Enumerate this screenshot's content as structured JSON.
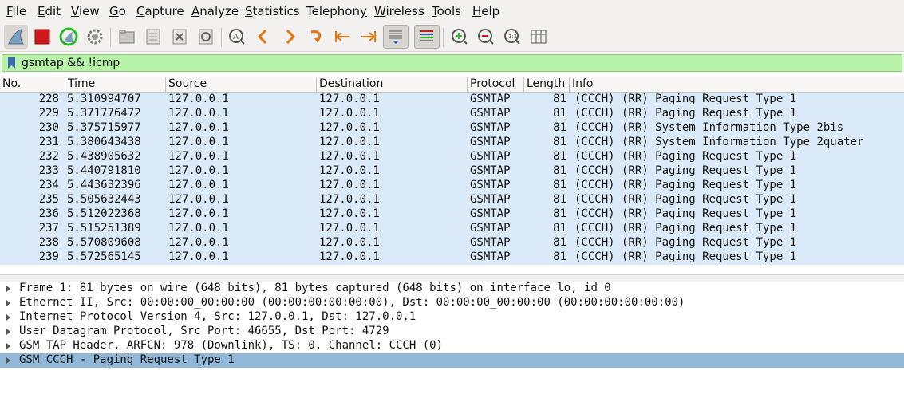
{
  "menu": [
    {
      "key": "F",
      "rest": "ile"
    },
    {
      "key": "E",
      "rest": "dit"
    },
    {
      "key": "V",
      "rest": "iew"
    },
    {
      "key": "G",
      "rest": "o"
    },
    {
      "key": "C",
      "rest": "apture"
    },
    {
      "key": "A",
      "rest": "nalyze"
    },
    {
      "key": "S",
      "rest": "tatistics"
    },
    {
      "key": "Telephon",
      "rest": "y",
      "key_first": true
    },
    {
      "key": "W",
      "rest": "ireless"
    },
    {
      "key": "T",
      "rest": "ools"
    },
    {
      "key": "H",
      "rest": "elp"
    }
  ],
  "toolbar": {
    "icons": [
      "shark-fin-start-icon",
      "stop-square-icon",
      "restart-fin-icon",
      "capture-options-gear-icon",
      "open-folder-icon",
      "save-file-icon",
      "close-file-icon",
      "reload-icon",
      "find-packet-icon",
      "go-back-icon",
      "go-forward-icon",
      "go-to-packet-icon",
      "go-first-icon",
      "go-last-icon",
      "autoscroll-icon",
      "colorize-icon",
      "zoom-in-icon",
      "zoom-out-icon",
      "zoom-normal-icon",
      "resize-columns-icon"
    ],
    "colors": {
      "stop": "#d0191b",
      "arrow": "#e8730c",
      "fin": "#7a9fc1",
      "restart": "#2eb82e"
    }
  },
  "filter": {
    "text": "gsmtap && !icmp",
    "bg_color": "#b8f2a9"
  },
  "columns": [
    "No.",
    "Time",
    "Source",
    "Destination",
    "Protocol",
    "Length",
    "Info"
  ],
  "packets": [
    {
      "no": "228",
      "time": "5.310994707",
      "src": "127.0.0.1",
      "dst": "127.0.0.1",
      "proto": "GSMTAP",
      "len": "81",
      "info": "(CCCH) (RR) Paging Request Type 1"
    },
    {
      "no": "229",
      "time": "5.371776472",
      "src": "127.0.0.1",
      "dst": "127.0.0.1",
      "proto": "GSMTAP",
      "len": "81",
      "info": "(CCCH) (RR) Paging Request Type 1"
    },
    {
      "no": "230",
      "time": "5.375715977",
      "src": "127.0.0.1",
      "dst": "127.0.0.1",
      "proto": "GSMTAP",
      "len": "81",
      "info": "(CCCH) (RR) System Information Type 2bis"
    },
    {
      "no": "231",
      "time": "5.380643438",
      "src": "127.0.0.1",
      "dst": "127.0.0.1",
      "proto": "GSMTAP",
      "len": "81",
      "info": "(CCCH) (RR) System Information Type 2quater"
    },
    {
      "no": "232",
      "time": "5.438905632",
      "src": "127.0.0.1",
      "dst": "127.0.0.1",
      "proto": "GSMTAP",
      "len": "81",
      "info": "(CCCH) (RR) Paging Request Type 1"
    },
    {
      "no": "233",
      "time": "5.440791810",
      "src": "127.0.0.1",
      "dst": "127.0.0.1",
      "proto": "GSMTAP",
      "len": "81",
      "info": "(CCCH) (RR) Paging Request Type 1"
    },
    {
      "no": "234",
      "time": "5.443632396",
      "src": "127.0.0.1",
      "dst": "127.0.0.1",
      "proto": "GSMTAP",
      "len": "81",
      "info": "(CCCH) (RR) Paging Request Type 1"
    },
    {
      "no": "235",
      "time": "5.505632443",
      "src": "127.0.0.1",
      "dst": "127.0.0.1",
      "proto": "GSMTAP",
      "len": "81",
      "info": "(CCCH) (RR) Paging Request Type 1"
    },
    {
      "no": "236",
      "time": "5.512022368",
      "src": "127.0.0.1",
      "dst": "127.0.0.1",
      "proto": "GSMTAP",
      "len": "81",
      "info": "(CCCH) (RR) Paging Request Type 1"
    },
    {
      "no": "237",
      "time": "5.515251389",
      "src": "127.0.0.1",
      "dst": "127.0.0.1",
      "proto": "GSMTAP",
      "len": "81",
      "info": "(CCCH) (RR) Paging Request Type 1"
    },
    {
      "no": "238",
      "time": "5.570809608",
      "src": "127.0.0.1",
      "dst": "127.0.0.1",
      "proto": "GSMTAP",
      "len": "81",
      "info": "(CCCH) (RR) Paging Request Type 1"
    },
    {
      "no": "239",
      "time": "5.572565145",
      "src": "127.0.0.1",
      "dst": "127.0.0.1",
      "proto": "GSMTAP",
      "len": "81",
      "info": "(CCCH) (RR) Paging Request Type 1"
    }
  ],
  "details": [
    {
      "text": "Frame 1: 81 bytes on wire (648 bits), 81 bytes captured (648 bits) on interface lo, id 0",
      "selected": false
    },
    {
      "text": "Ethernet II, Src: 00:00:00_00:00:00 (00:00:00:00:00:00), Dst: 00:00:00_00:00:00 (00:00:00:00:00:00)",
      "selected": false
    },
    {
      "text": "Internet Protocol Version 4, Src: 127.0.0.1, Dst: 127.0.0.1",
      "selected": false
    },
    {
      "text": "User Datagram Protocol, Src Port: 46655, Dst Port: 4729",
      "selected": false
    },
    {
      "text": "GSM TAP Header, ARFCN: 978 (Downlink), TS: 0, Channel: CCCH (0)",
      "selected": false
    },
    {
      "text": "GSM CCCH - Paging Request Type 1",
      "selected": true
    }
  ],
  "colors": {
    "row_bg": "#dbeaf8",
    "selected_detail_bg": "#91b7d9"
  }
}
